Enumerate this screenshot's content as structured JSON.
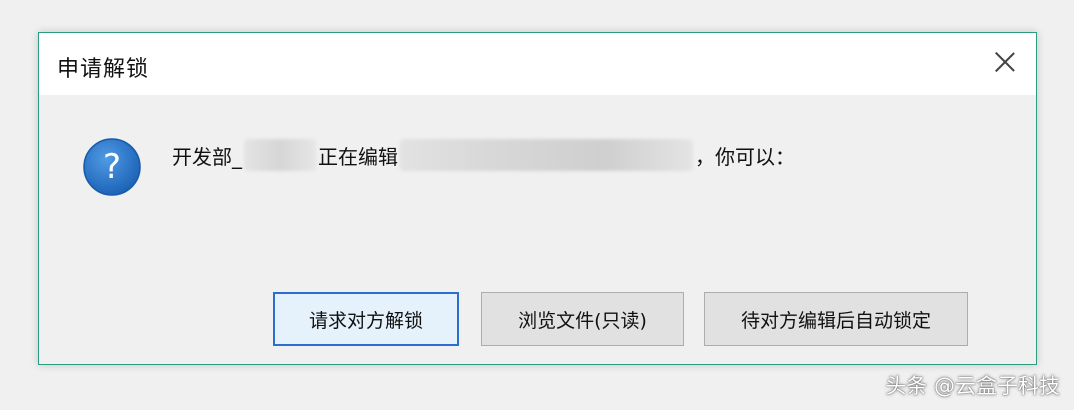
{
  "dialog": {
    "title": "申请解锁",
    "message": {
      "prefix": "开发部_",
      "middle": "正在编辑",
      "suffix": "，你可以："
    },
    "buttons": {
      "request_unlock": "请求对方解锁",
      "browse_readonly": "浏览文件(只读)",
      "wait_auto_lock": "待对方编辑后自动锁定"
    },
    "icons": {
      "close": "close-icon",
      "question": "question-icon"
    },
    "colors": {
      "border": "#2b9c7f",
      "primary_button_border": "#2a6fd0",
      "question_icon": "#1f6fc5"
    }
  },
  "watermark": "头条 @云盒子科技"
}
